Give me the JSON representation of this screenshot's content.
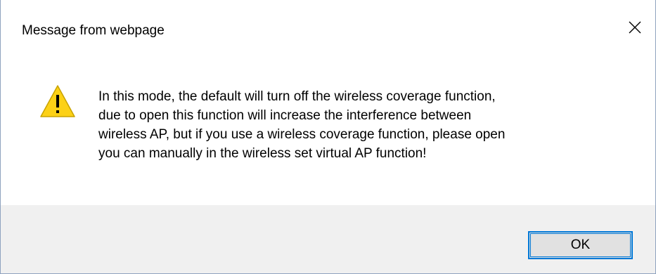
{
  "window": {
    "title": "Message from webpage",
    "close_icon": "close-icon"
  },
  "message": {
    "icon": "warning-icon",
    "lines": [
      "In this mode, the default will turn off the wireless coverage function,",
      "due to open this function will increase the interference between",
      "wireless AP, but if you use a wireless coverage function, please open",
      "you can manually in the wireless set virtual AP function!"
    ]
  },
  "buttons": {
    "ok_label": "OK"
  },
  "colors": {
    "accent": "#0078d7",
    "warning_fill": "#fcd116",
    "footer_bg": "#f0f0f0",
    "border": "#8fa3bf"
  }
}
